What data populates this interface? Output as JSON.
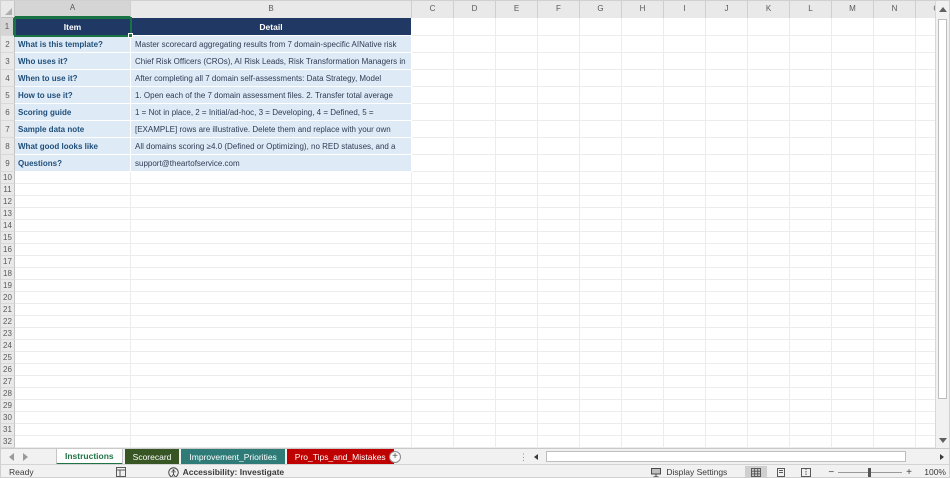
{
  "grid": {
    "columns": [
      "A",
      "B",
      "C",
      "D",
      "E",
      "F",
      "G",
      "H",
      "I",
      "J",
      "K",
      "L",
      "M",
      "N",
      "O"
    ],
    "row_count": 32,
    "selection": {
      "cell": "A1",
      "col": "A",
      "row": 1
    },
    "table": {
      "header": {
        "item": "Item",
        "detail": "Detail"
      },
      "rows": [
        {
          "item": "What is this template?",
          "detail": "Master scorecard aggregating results from 7 domain-specific AINative risk"
        },
        {
          "item": "Who uses it?",
          "detail": "Chief Risk Officers (CROs), AI Risk Leads, Risk Transformation Managers in"
        },
        {
          "item": "When to use it?",
          "detail": "After completing all 7 domain self-assessments: Data Strategy, Model"
        },
        {
          "item": "How to use it?",
          "detail": "1. Open each of the 7 domain assessment files. 2. Transfer total average"
        },
        {
          "item": "Scoring guide",
          "detail": "1 = Not in place, 2 = Initial/ad-hoc, 3 = Developing, 4 = Defined, 5 ="
        },
        {
          "item": "Sample data note",
          "detail": "[EXAMPLE] rows are illustrative. Delete them and replace with your own"
        },
        {
          "item": "What good looks like",
          "detail": "All domains scoring ≥4.0 (Defined or Optimizing), no RED statuses, and a"
        },
        {
          "item": "Questions?",
          "detail": "support@theartofservice.com"
        }
      ]
    }
  },
  "tabs": {
    "items": [
      {
        "label": "Instructions",
        "active": true,
        "text_color": "#217346"
      },
      {
        "label": "Scorecard",
        "color": "#375623"
      },
      {
        "label": "Improvement_Priorities",
        "color": "#2E7B78"
      },
      {
        "label": "Pro_Tips_and_Mistakes",
        "color": "#C00000"
      }
    ],
    "new_sheet_glyph": "+",
    "splitter_glyph": "⋮"
  },
  "status_bar": {
    "ready_label": "Ready",
    "accessibility_label": "Accessibility: Investigate",
    "display_settings_label": "Display Settings",
    "zoom_out_glyph": "−",
    "zoom_in_glyph": "+",
    "zoom_level": "100%"
  },
  "colors": {
    "table_header_bg": "#1F3864",
    "table_row_bg": "#DEEBF7",
    "item_text": "#1F4E79",
    "selection_green": "#1A7344",
    "active_tab_text": "#217346"
  }
}
